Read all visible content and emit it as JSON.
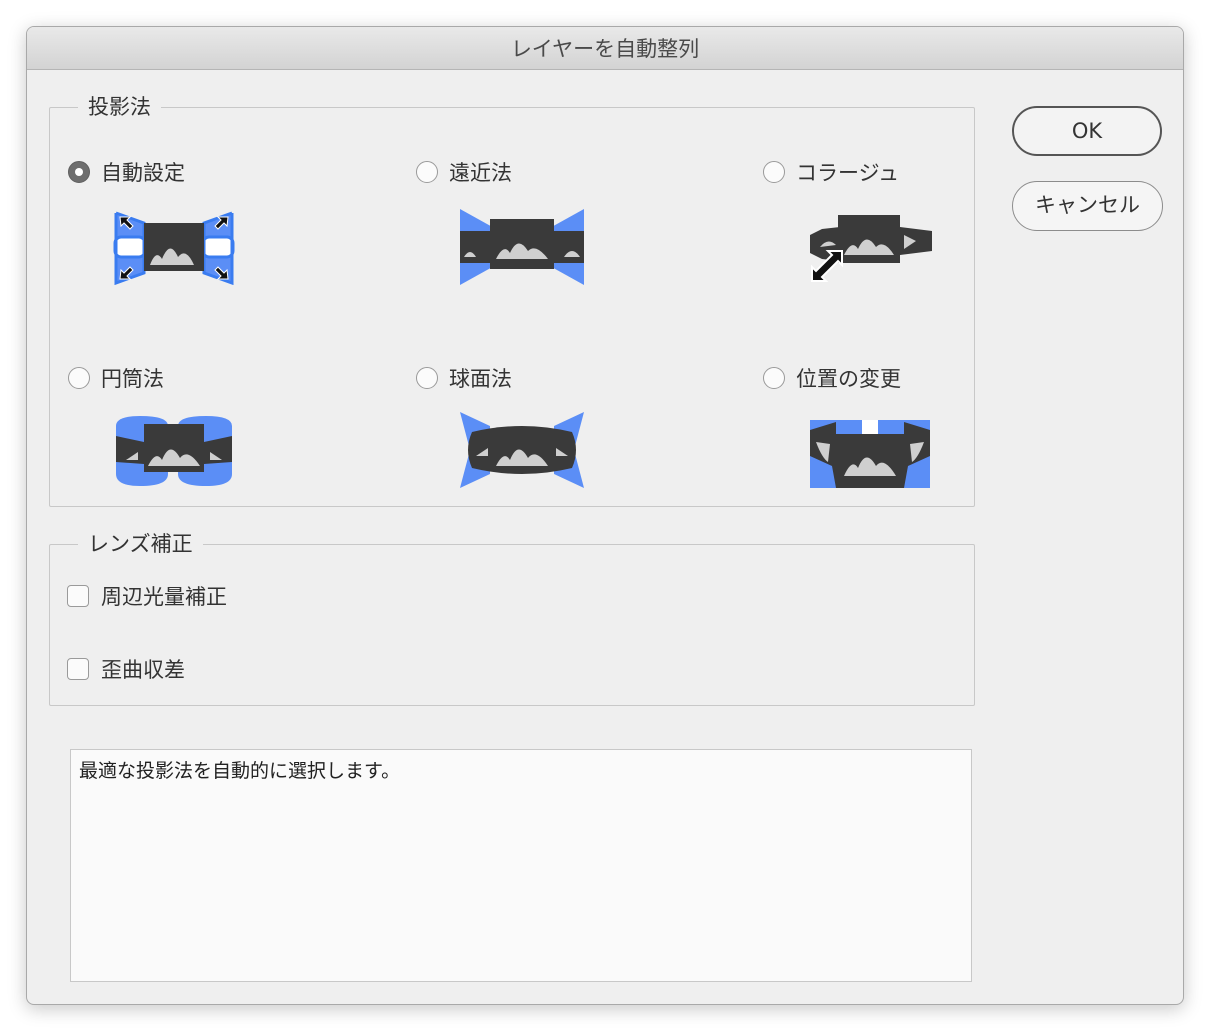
{
  "dialog": {
    "title": "レイヤーを自動整列"
  },
  "projection": {
    "legend": "投影法",
    "options": [
      {
        "label": "自動設定",
        "selected": true,
        "icon": "auto-projection-icon"
      },
      {
        "label": "遠近法",
        "selected": false,
        "icon": "perspective-projection-icon"
      },
      {
        "label": "コラージュ",
        "selected": false,
        "icon": "collage-projection-icon"
      },
      {
        "label": "円筒法",
        "selected": false,
        "icon": "cylindrical-projection-icon"
      },
      {
        "label": "球面法",
        "selected": false,
        "icon": "spherical-projection-icon"
      },
      {
        "label": "位置の変更",
        "selected": false,
        "icon": "reposition-projection-icon"
      }
    ]
  },
  "lens": {
    "legend": "レンズ補正",
    "vignette_label": "周辺光量補正",
    "vignette_checked": false,
    "distortion_label": "歪曲収差",
    "distortion_checked": false
  },
  "buttons": {
    "ok": "OK",
    "cancel": "キャンセル"
  },
  "description": "最適な投影法を自動的に選択します。",
  "colors": {
    "accent": "#5b8ef6",
    "icon_dark": "#3a3a3a",
    "icon_outline_blue": "#3a7cf0"
  }
}
